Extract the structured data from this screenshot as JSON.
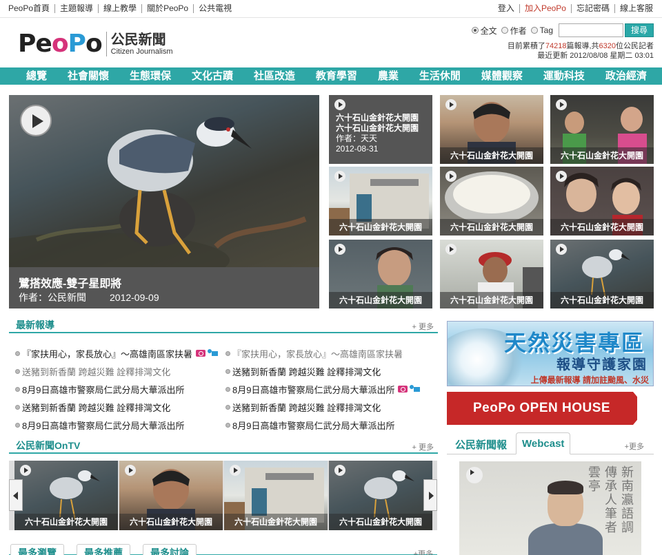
{
  "topbar": {
    "left": [
      "PeoPo首頁",
      "主題報導",
      "線上教學",
      "關於PeoPo",
      "公共電視"
    ],
    "right": [
      "登入",
      "加入PeoPo",
      "忘記密碼",
      "線上客服"
    ]
  },
  "logo": {
    "brand": "PeoPo",
    "cn": "公民新聞",
    "en": "Citizen Journalism"
  },
  "search": {
    "options": [
      "全文",
      "作者",
      "Tag"
    ],
    "selected": "全文",
    "value": "",
    "button": "搜尋"
  },
  "stats": {
    "prefix": "目前累積了",
    "articles": "74218",
    "mid": "篇報導,共",
    "reporters": "6320",
    "suffix": "位公民記者",
    "updated": "最近更新 2012/08/08 星期二 03:01"
  },
  "nav": [
    "總覽",
    "社會關懷",
    "生態環保",
    "文化古蹟",
    "社區改造",
    "教育學習",
    "農業",
    "生活休閒",
    "媒體觀察",
    "運動科技",
    "政治經濟"
  ],
  "feature": {
    "title": "鷺搭效應-雙子星即將",
    "author": "作者：公民新聞",
    "date": "2012-09-09"
  },
  "thumb_first": {
    "title1": "六十石山金針花大開園",
    "title2": "六十石山金針花大開園",
    "author": "作者：天天",
    "date": "2012-08-31"
  },
  "thumbs": [
    "六十石山金針花大開園",
    "六十石山金針花大開園",
    "六十石山金針花大開園",
    "六十石山金針花大開園",
    "六十石山金針花大開園",
    "六十石山金針花大開園",
    "六十石山金針花大開園",
    "六十石山金針花大開園"
  ],
  "latest": {
    "title": "最新報導",
    "more": "+ 更多",
    "rows": [
      [
        "『家扶用心，家長放心』～高雄南區家扶暑",
        "『家扶用心，家長放心』～高雄南區家扶暑"
      ],
      [
        "送豬到新香蘭 跨越災難 詮釋排灣文化",
        "送豬到新香蘭 跨越災難 詮釋排灣文化"
      ],
      [
        "8月9日高雄市警察局仁武分局大華派出所",
        "8月9日高雄市警察局仁武分局大華派出所"
      ],
      [
        "送豬到新香蘭 跨越災難 詮釋排灣文化",
        "送豬到新香蘭 跨越災難 詮釋排灣文化"
      ],
      [
        "8月9日高雄市警察局仁武分局大華派出所",
        "8月9日高雄市警察局仁武分局大華派出所"
      ]
    ]
  },
  "ontv": {
    "title": "公民新聞OnTV",
    "more": "+ 更多",
    "items": [
      "六十石山金針花大開園",
      "六十石山金針花大開園",
      "六十石山金針花大開園",
      "六十石山金針花大開園"
    ]
  },
  "bottom_tabs": [
    "最多瀏覽",
    "最多推薦",
    "最多討論"
  ],
  "bottom_more": "+更多",
  "banner_disaster": {
    "t1": "天然災害專區",
    "t2": "報導守護家園",
    "t3": "上傳最新報導 請加註颱風、水災"
  },
  "banner_openhouse": "PeoPo OPEN HOUSE",
  "right_tabs": {
    "tab1": "公民新聞報",
    "tab2": "Webcast",
    "more": "+更多"
  },
  "colors": {
    "accent": "#2ea7a6",
    "red": "#c0392b",
    "pink": "#d5337a",
    "blue": "#2a9ad5"
  }
}
